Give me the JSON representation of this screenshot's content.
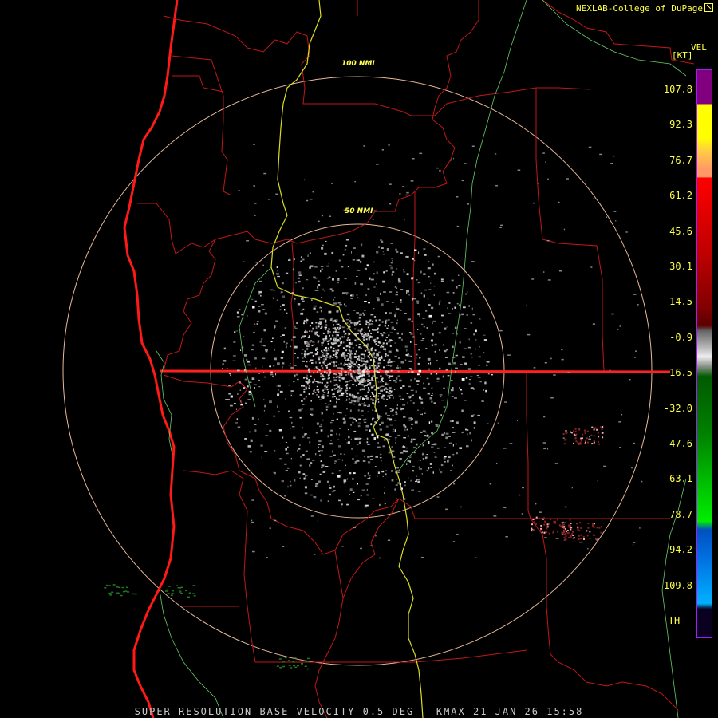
{
  "credit": "NEXLAB-College of DuPage",
  "legend": {
    "title": "VEL",
    "unit": "[KT]",
    "ticks": [
      "107.8",
      "92.3",
      "76.7",
      "61.2",
      "45.6",
      "30.1",
      "14.5",
      "-0.9",
      "-16.5",
      "-32.0",
      "-47.6",
      "-63.1",
      "-78.7",
      "-94.2",
      "-109.8",
      "TH"
    ],
    "colors": {
      "purple": "#800080",
      "yellow": "#ffff00",
      "peach": "#ff9966",
      "red": "#ff0000",
      "darkred": "#5a0000",
      "gray": "#bbbbbb",
      "darkgreen": "#005a00",
      "green": "#00ee00",
      "blue": "#0050c0",
      "cyan": "#00b0ff",
      "th": "#0a0020"
    }
  },
  "rings": {
    "inner": "50 NMI",
    "outer": "100 NMI"
  },
  "footer": "SUPER-RESOLUTION BASE VELOCITY 0.5 DEG - KMAX 21 JAN 26 15:58"
}
